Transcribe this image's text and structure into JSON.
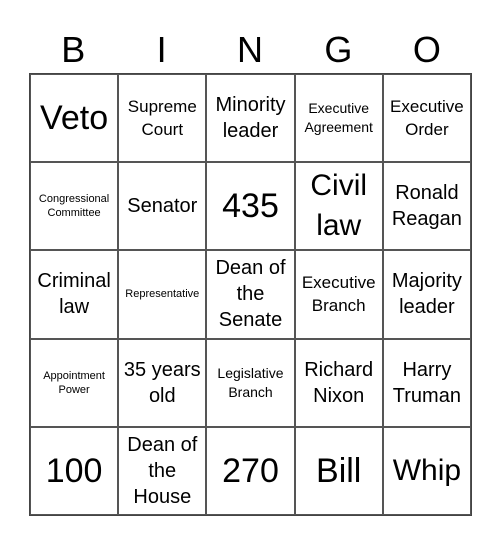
{
  "header": {
    "letters": [
      "B",
      "I",
      "N",
      "G",
      "O"
    ]
  },
  "cells": [
    [
      "Veto",
      "Supreme Court",
      "Minority leader",
      "Executive Agreement",
      "Executive Order"
    ],
    [
      "Congressional Committee",
      "Senator",
      "435",
      "Civil law",
      "Ronald Reagan"
    ],
    [
      "Criminal law",
      "Representative",
      "Dean of the Senate",
      "Executive Branch",
      "Majority leader"
    ],
    [
      "Appointment Power",
      "35 years old",
      "Legislative Branch",
      "Richard Nixon",
      "Harry Truman"
    ],
    [
      "100",
      "Dean of the House",
      "270",
      "Bill",
      "Whip"
    ]
  ]
}
